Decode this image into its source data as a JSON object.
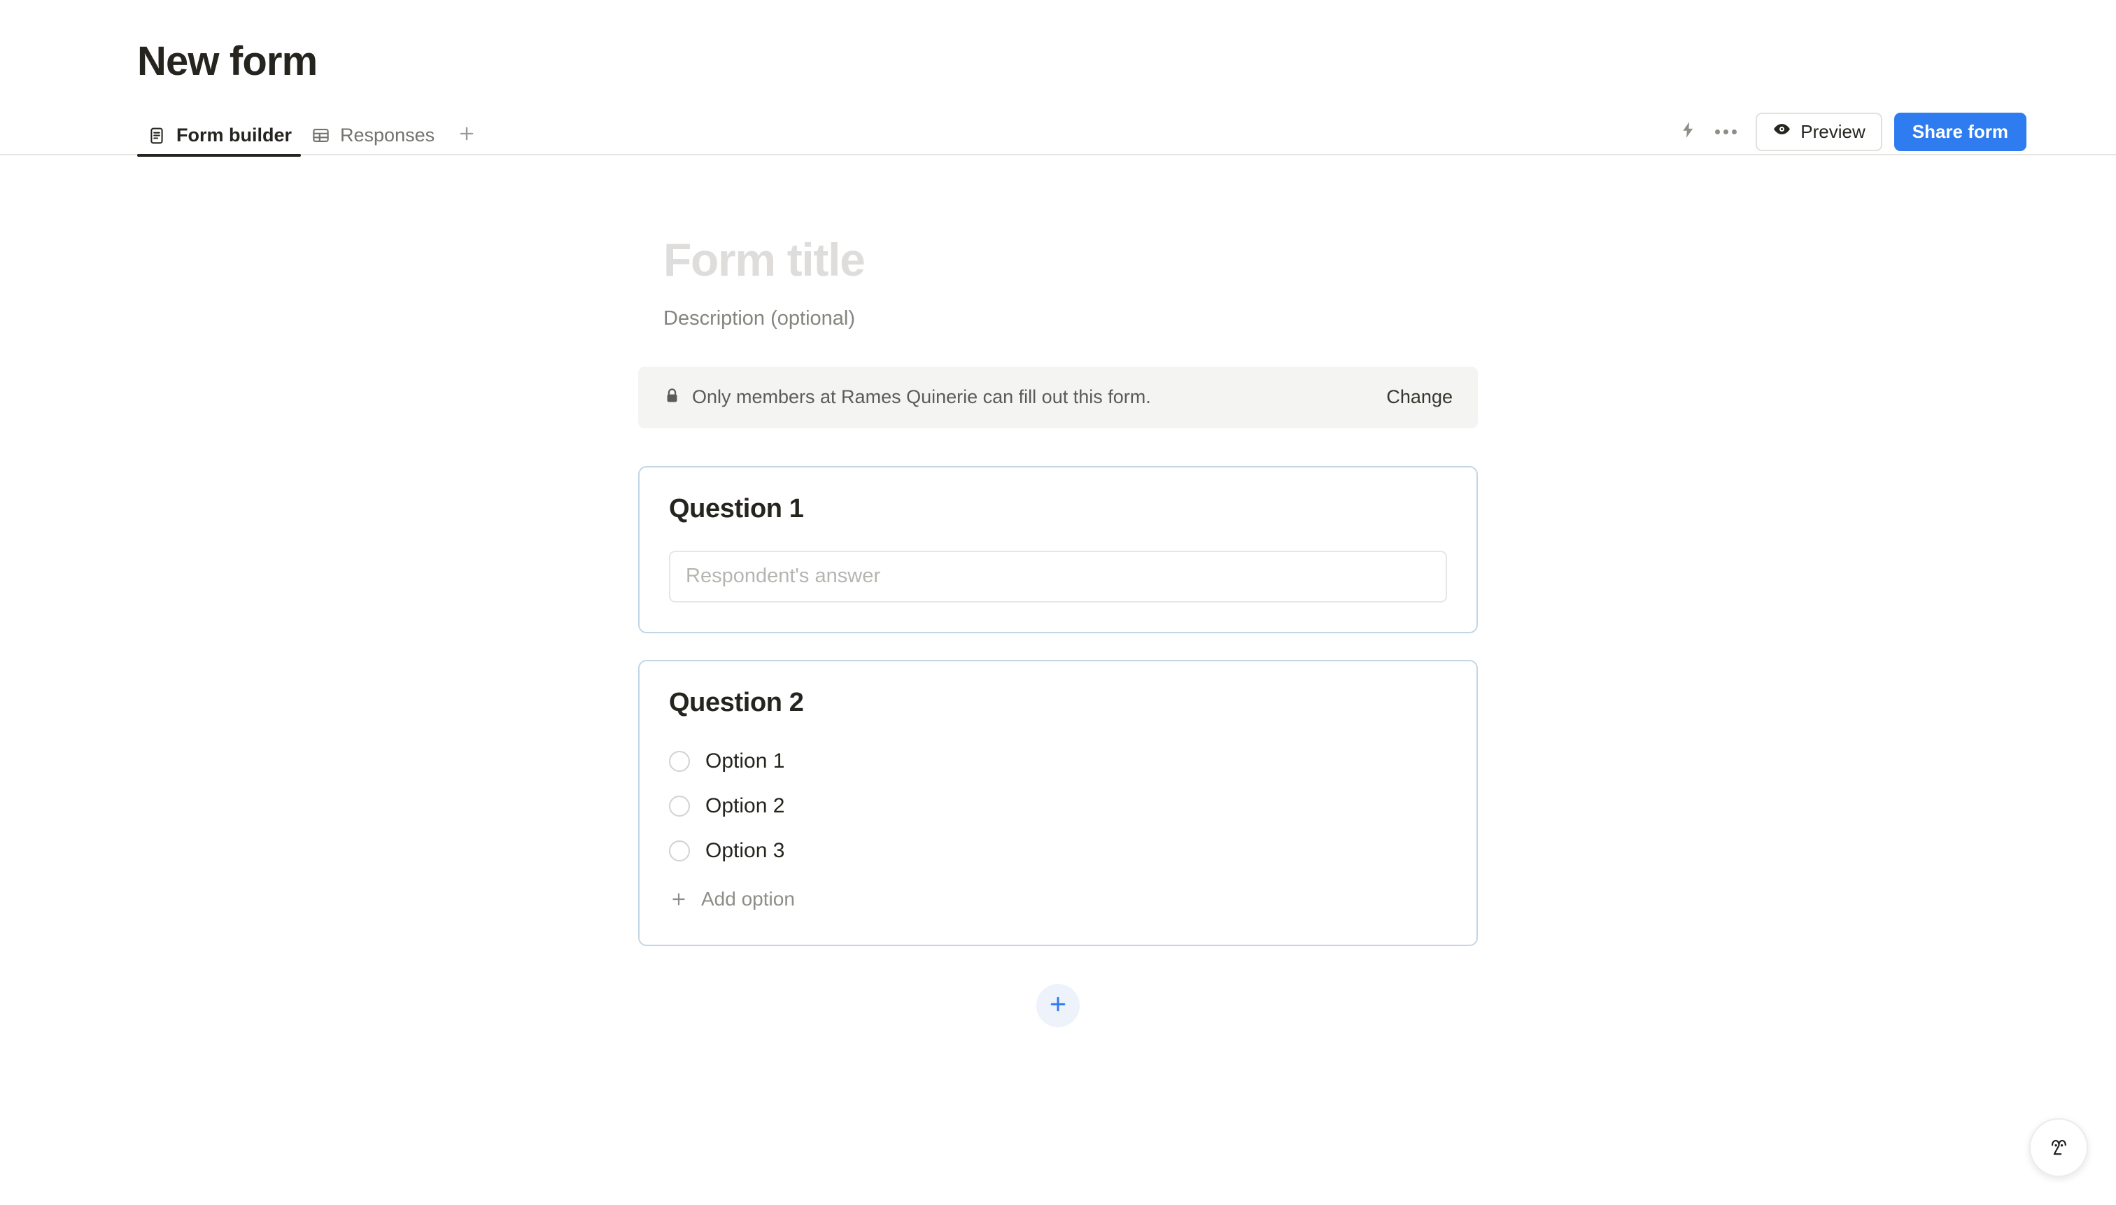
{
  "header": {
    "title": "New form",
    "tabs": [
      {
        "label": "Form builder",
        "icon": "document-icon",
        "active": true
      },
      {
        "label": "Responses",
        "icon": "table-icon",
        "active": false
      }
    ],
    "add_tab_icon": "plus-icon",
    "actions": {
      "automations_icon": "lightning-bolt-icon",
      "more_icon": "ellipsis-icon",
      "preview_label": "Preview",
      "preview_icon": "eye-icon",
      "share_label": "Share form"
    }
  },
  "form": {
    "title_placeholder": "Form title",
    "description_placeholder": "Description (optional)",
    "permission": {
      "icon": "lock-icon",
      "text": "Only members at Rames Quinerie can fill out this form.",
      "change_label": "Change"
    },
    "questions": [
      {
        "title": "Question 1",
        "type": "short-answer",
        "answer_placeholder": "Respondent's answer"
      },
      {
        "title": "Question 2",
        "type": "multiple-choice",
        "options": [
          "Option 1",
          "Option 2",
          "Option 3"
        ],
        "add_option_label": "Add option"
      }
    ],
    "add_block_icon": "plus-icon"
  },
  "assistant": {
    "icon": "assistant-face-icon"
  },
  "colors": {
    "accent_blue": "#2e7cf0",
    "card_border": "#c2d6e6",
    "banner_bg": "#f4f4f2",
    "text_primary": "#25241f",
    "text_muted": "#8e8d88"
  }
}
